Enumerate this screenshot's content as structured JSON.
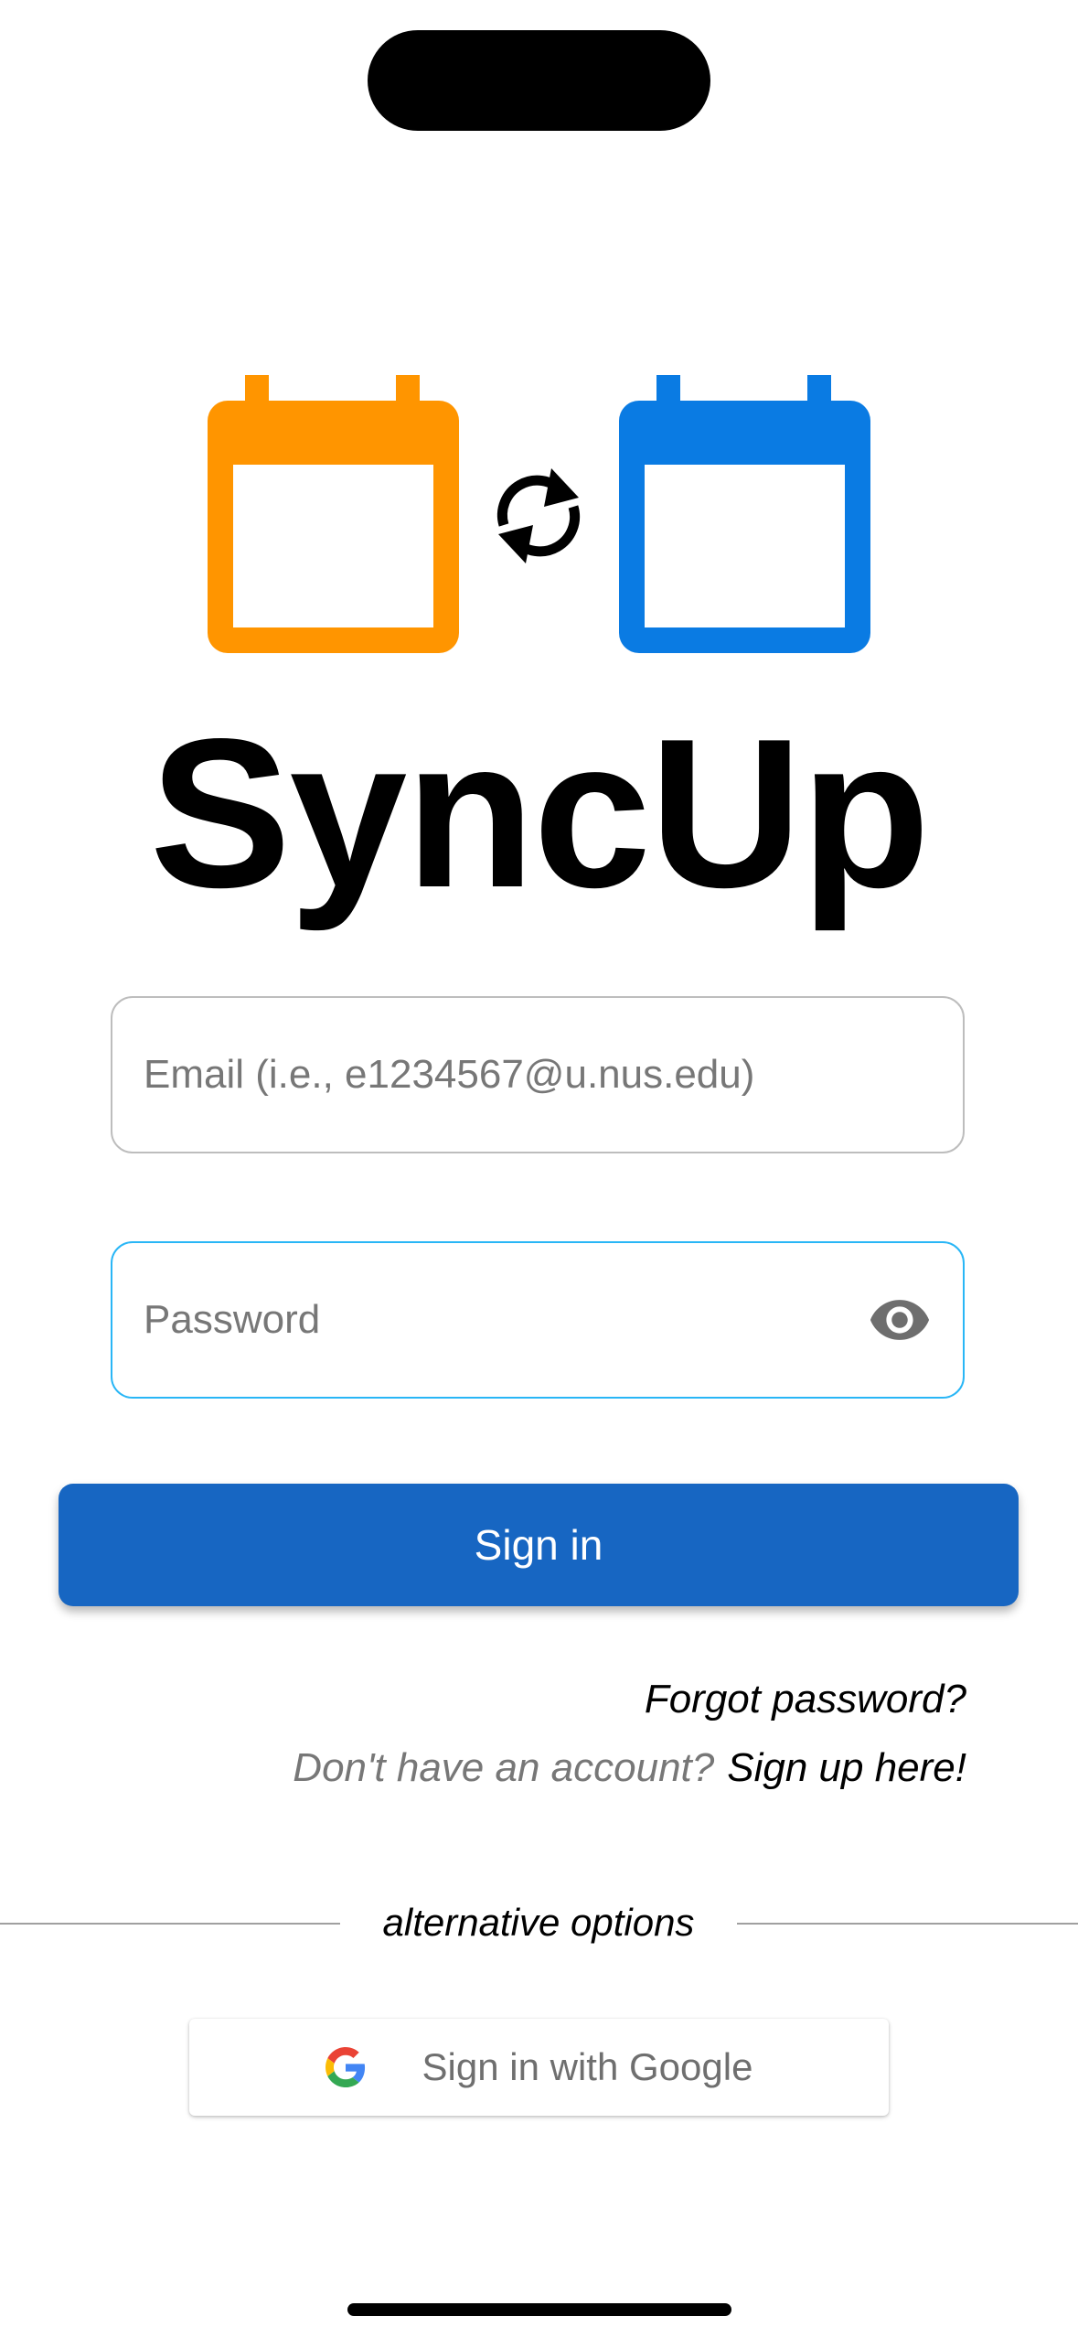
{
  "app": {
    "title": "SyncUp"
  },
  "logo": {
    "left_icon": "calendar-icon",
    "middle_icon": "sync-icon",
    "right_icon": "calendar-icon",
    "colors": {
      "left_calendar": "#ff9500",
      "right_calendar": "#0a7be3",
      "sync": "#000000"
    }
  },
  "form": {
    "email_placeholder": "Email (i.e., e1234567@u.nus.edu)",
    "email_value": "",
    "password_placeholder": "Password",
    "password_value": "",
    "password_visibility_icon": "eye-icon",
    "signin_label": "Sign in"
  },
  "links": {
    "forgot_password": "Forgot password?",
    "no_account_prompt": "Don't have an account?",
    "signup": "Sign up here!"
  },
  "alternatives": {
    "divider_label": "alternative options",
    "google_label": "Sign in with Google",
    "google_icon": "google-icon"
  },
  "theme": {
    "primary": "#1766c2",
    "focus_border": "#29b6f6",
    "idle_border": "#bdbdbd"
  }
}
